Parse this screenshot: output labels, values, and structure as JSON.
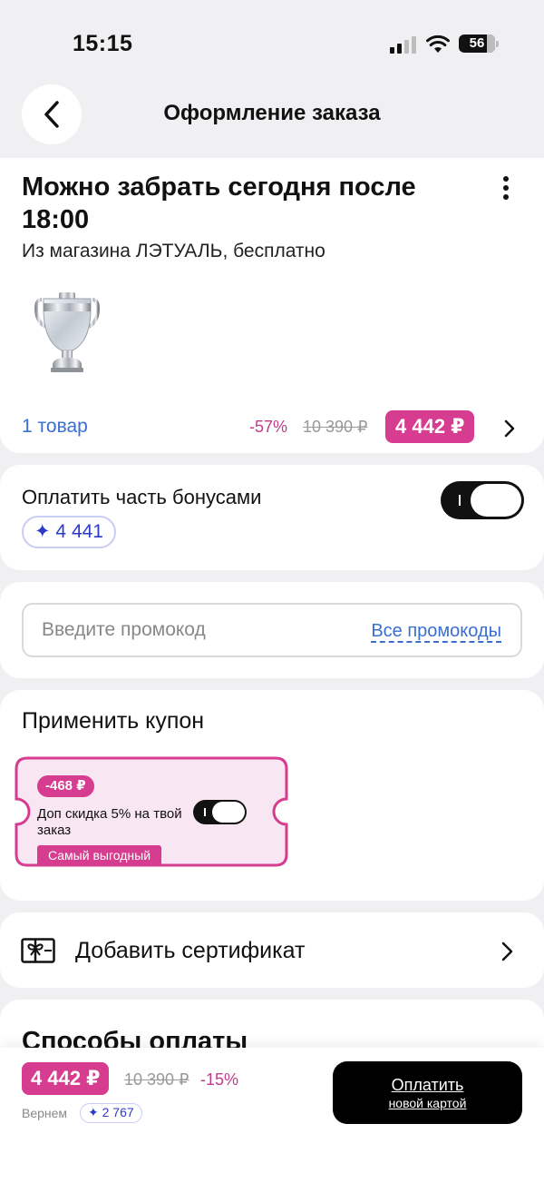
{
  "status_bar": {
    "time": "15:15",
    "battery": "56"
  },
  "header": {
    "title": "Оформление заказа"
  },
  "delivery": {
    "title": "Можно забрать сегодня после 18:00",
    "subtitle": "Из магазина ЛЭТУАЛЬ, бесплатно",
    "items_count": "1 товар",
    "discount": "-57%",
    "old_price": "10 390 ₽",
    "price": "4 442 ₽"
  },
  "bonus": {
    "label": "Оплатить часть бонусами",
    "amount": "✦ 4 441",
    "toggle_on": true
  },
  "promo": {
    "placeholder": "Введите промокод",
    "all_link": "Все промокоды"
  },
  "coupon": {
    "section_title": "Применить купон",
    "amount": "-468 ₽",
    "description": "Доп скидка 5% на твой заказ",
    "tag": "Самый выгодный",
    "toggle_on": true
  },
  "certificate": {
    "label": "Добавить сертификат"
  },
  "payment": {
    "title": "Способы оплаты"
  },
  "bottom": {
    "price": "4 442 ₽",
    "old_price": "10 390 ₽",
    "discount": "-15%",
    "cashback_label": "Вернем",
    "cashback_amount": "✦ 2 767",
    "pay_label": "Оплатить",
    "pay_sub": "новой картой"
  },
  "colors": {
    "accent_pink": "#d63c8f",
    "bonus_blue": "#2b3bc8",
    "link_blue": "#3a6fd0",
    "background": "#f0f0f2"
  }
}
